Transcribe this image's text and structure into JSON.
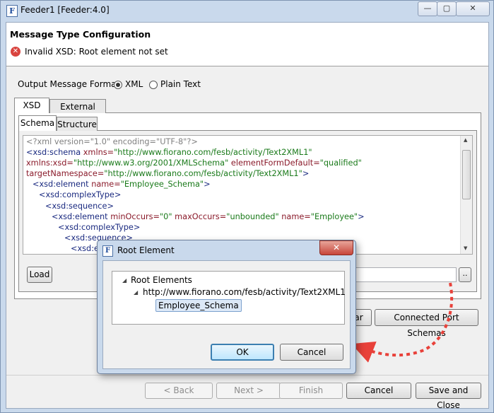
{
  "window": {
    "title": "Feeder1 [Feeder:4.0]",
    "icon_letter": "F",
    "controls": {
      "minimize": "—",
      "maximize": "▢",
      "close": "✕"
    }
  },
  "header": {
    "title": "Message Type Configuration",
    "error_message": "Invalid XSD: Root element not set",
    "error_icon": "error-icon"
  },
  "output_format": {
    "label": "Output Message Format:",
    "options": [
      {
        "label": "XML",
        "selected": true
      },
      {
        "label": "Plain Text",
        "selected": false
      }
    ]
  },
  "tabs": {
    "outer": [
      "XSD",
      "External XSDs"
    ],
    "inner": [
      "Schema",
      "Structure"
    ]
  },
  "schema_lines": [
    {
      "indent": 0,
      "parts": [
        {
          "c": "c-gray",
          "t": "<?xml version=\"1.0\" encoding=\"UTF-8\"?>"
        }
      ]
    },
    {
      "indent": 0,
      "parts": [
        {
          "c": "c-tag",
          "t": "<xsd:schema "
        },
        {
          "c": "c-attr",
          "t": "xmlns="
        },
        {
          "c": "c-val",
          "t": "\"http://www.fiorano.com/fesb/activity/Text2XML1\""
        }
      ]
    },
    {
      "indent": 0,
      "parts": [
        {
          "c": "c-attr",
          "t": "xmlns:xsd="
        },
        {
          "c": "c-val",
          "t": "\"http://www.w3.org/2001/XMLSchema\" "
        },
        {
          "c": "c-attr",
          "t": "elementFormDefault="
        },
        {
          "c": "c-val",
          "t": "\"qualified\""
        }
      ]
    },
    {
      "indent": 0,
      "parts": [
        {
          "c": "c-attr",
          "t": "targetNamespace="
        },
        {
          "c": "c-val",
          "t": "\"http://www.fiorano.com/fesb/activity/Text2XML1\""
        },
        {
          "c": "c-tag",
          "t": ">"
        }
      ]
    },
    {
      "indent": 1,
      "parts": [
        {
          "c": "c-tag",
          "t": "<xsd:element "
        },
        {
          "c": "c-attr",
          "t": "name="
        },
        {
          "c": "c-val",
          "t": "\"Employee_Schema\""
        },
        {
          "c": "c-tag",
          "t": ">"
        }
      ]
    },
    {
      "indent": 2,
      "parts": [
        {
          "c": "c-tag",
          "t": "<xsd:complexType>"
        }
      ]
    },
    {
      "indent": 3,
      "parts": [
        {
          "c": "c-tag",
          "t": "<xsd:sequence>"
        }
      ]
    },
    {
      "indent": 4,
      "parts": [
        {
          "c": "c-tag",
          "t": "<xsd:element "
        },
        {
          "c": "c-attr",
          "t": "minOccurs="
        },
        {
          "c": "c-val",
          "t": "\"0\" "
        },
        {
          "c": "c-attr",
          "t": "maxOccurs="
        },
        {
          "c": "c-val",
          "t": "\"unbounded\" "
        },
        {
          "c": "c-attr",
          "t": "name="
        },
        {
          "c": "c-val",
          "t": "\"Employee\""
        },
        {
          "c": "c-tag",
          "t": ">"
        }
      ]
    },
    {
      "indent": 5,
      "parts": [
        {
          "c": "c-tag",
          "t": "<xsd:complexType>"
        }
      ]
    },
    {
      "indent": 6,
      "parts": [
        {
          "c": "c-tag",
          "t": "<xsd:sequence>"
        }
      ]
    },
    {
      "indent": 7,
      "parts": [
        {
          "c": "c-tag",
          "t": "<xsd:el"
        }
      ]
    }
  ],
  "buttons": {
    "load": "Load",
    "browse": "..",
    "clear": "ar",
    "connected_port_schemas": "Connected Port Schemas",
    "back": "< Back",
    "next": "Next >",
    "finish": "Finish",
    "cancel": "Cancel",
    "save_and_close": "Save and Close"
  },
  "dialog": {
    "title": "Root Element",
    "icon_letter": "F",
    "close": "✕",
    "tree": {
      "root": "Root Elements",
      "namespace": "http://www.fiorano.com/fesb/activity/Text2XML1",
      "element": "Employee_Schema"
    },
    "ok": "OK",
    "cancel": "Cancel"
  },
  "colors": {
    "annotation_arrow": "#e8413a",
    "accent": "#3c7fb1",
    "error": "#d9443f"
  }
}
